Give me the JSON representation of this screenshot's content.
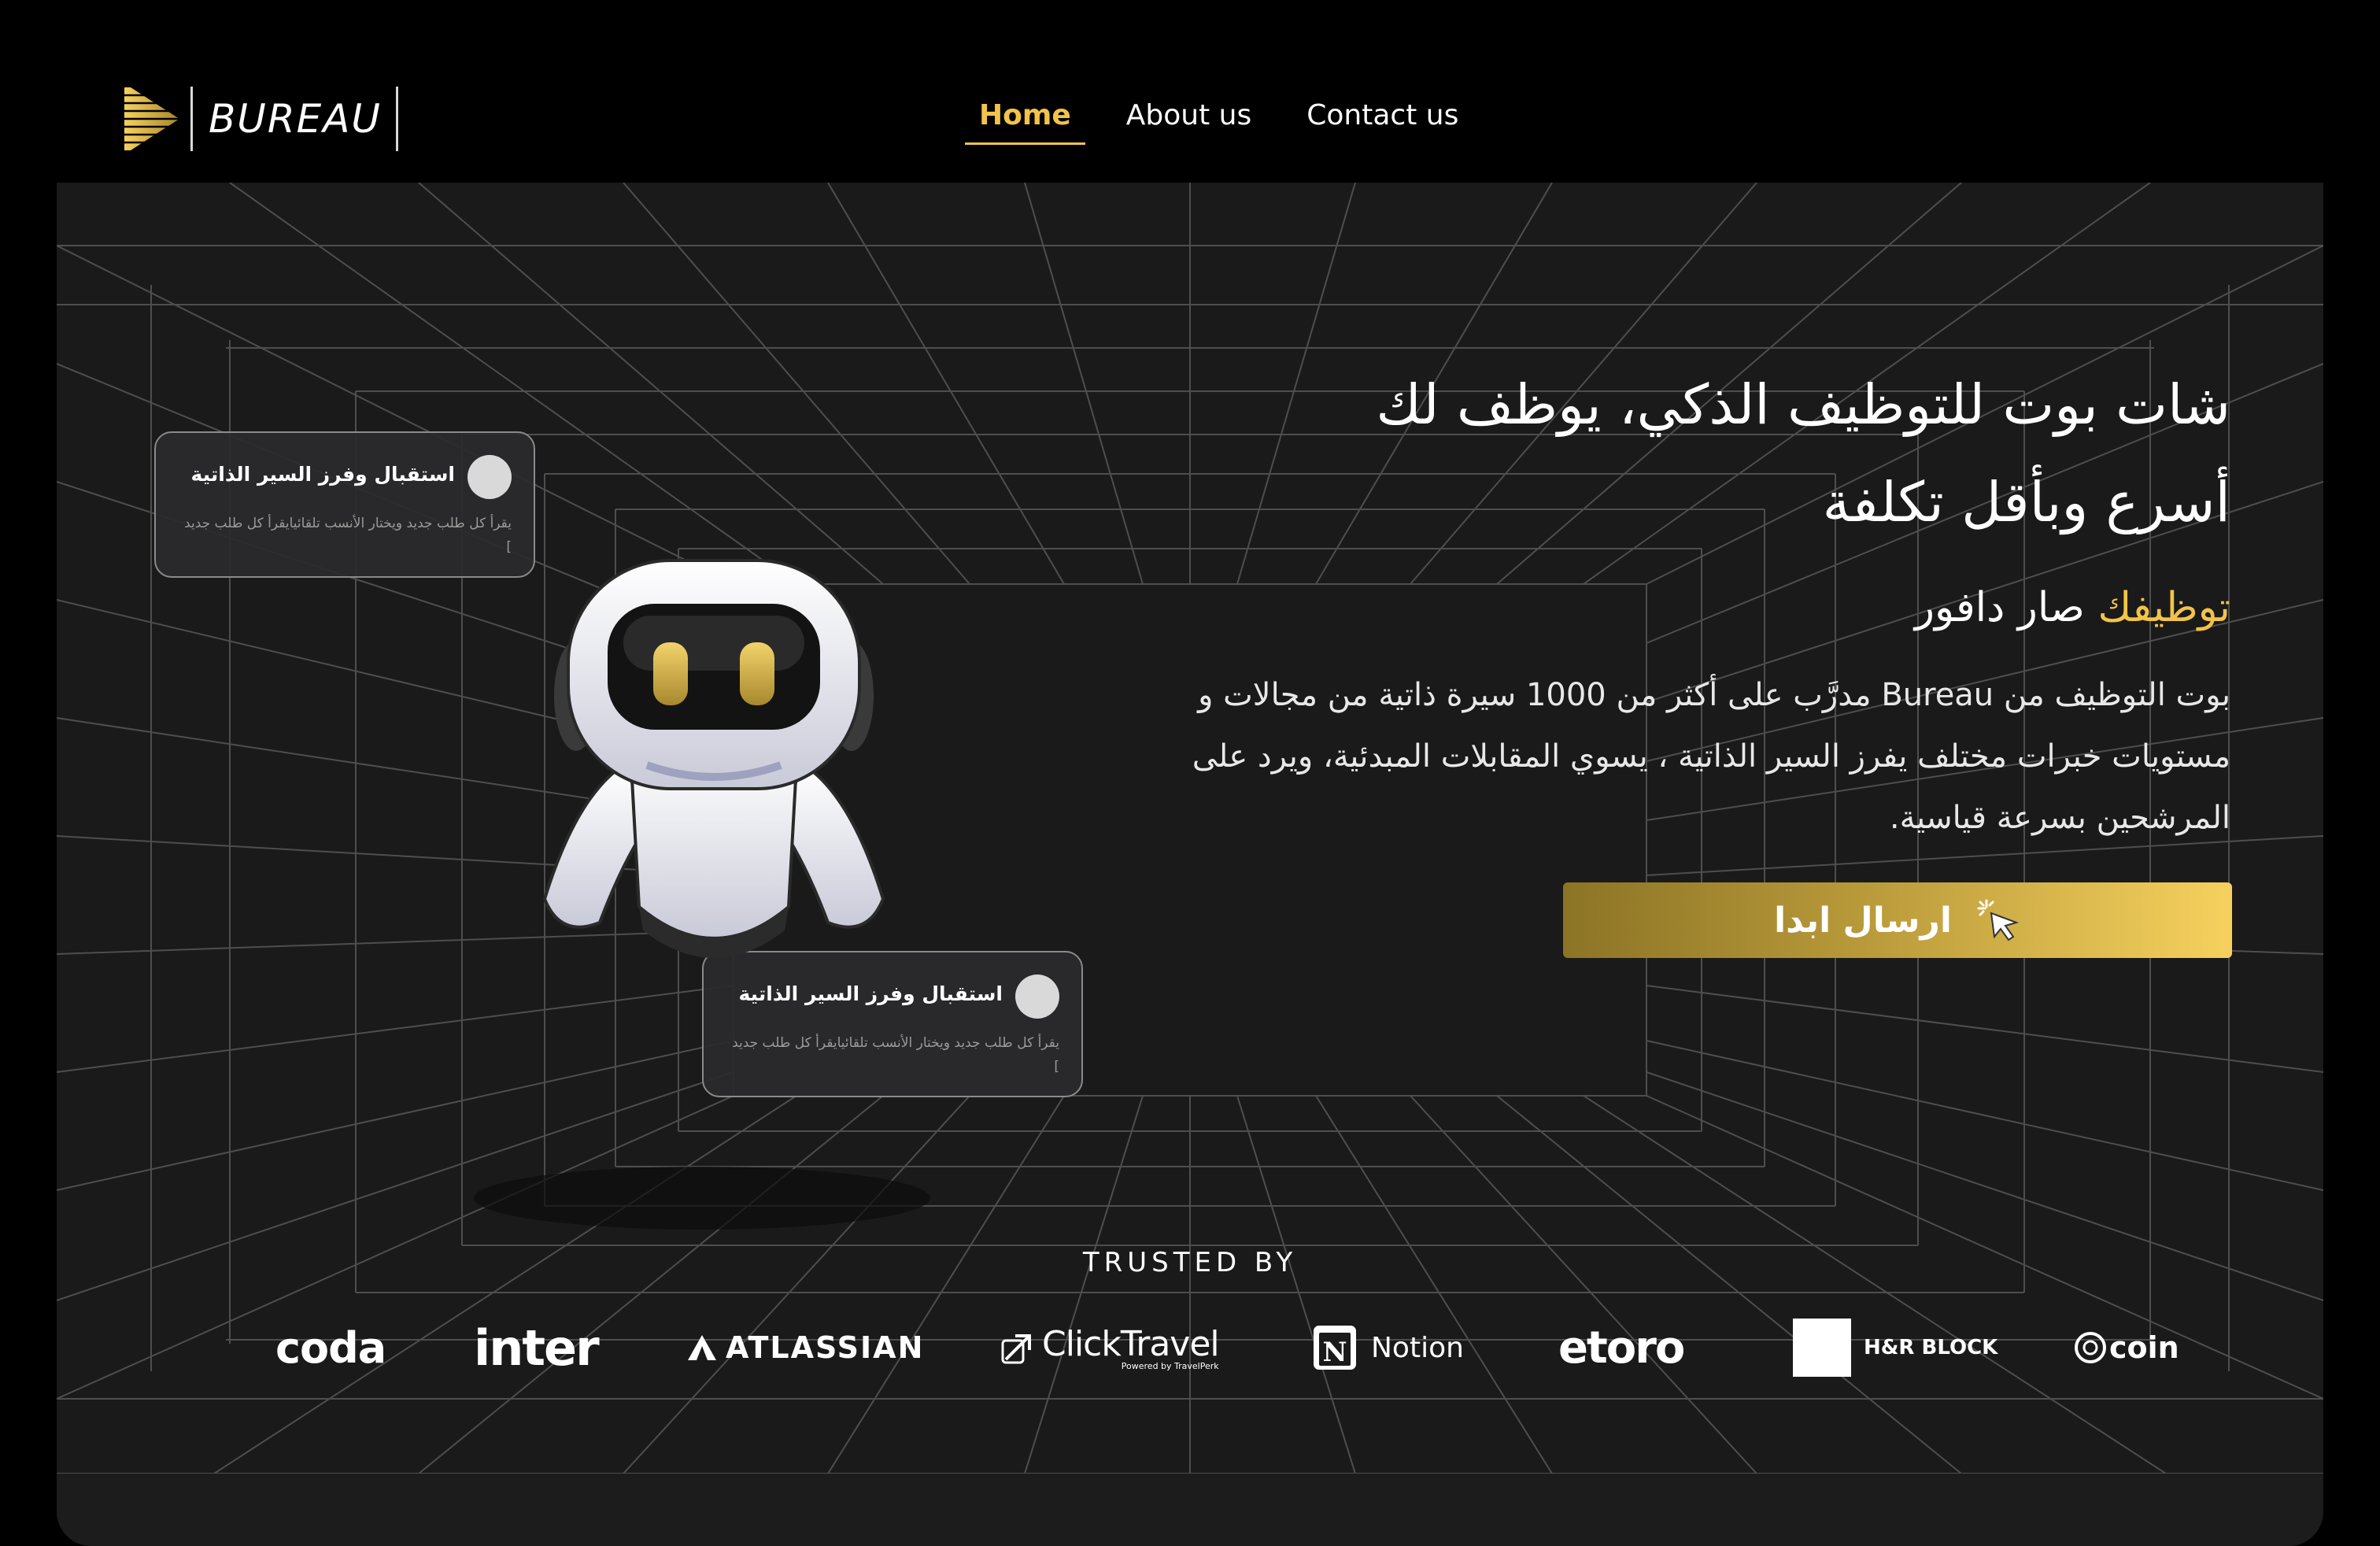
{
  "brand": {
    "name": "BUREAU",
    "logo_icon": "gold-speed-lines-icon"
  },
  "nav": {
    "items": [
      {
        "label": "Home",
        "active": true
      },
      {
        "label": "About us",
        "active": false
      },
      {
        "label": "Contact us",
        "active": false
      }
    ]
  },
  "hero": {
    "headline_line1": "شات بوت للتوظيف الذكي، يوظف لك",
    "headline_line2": "أسرع وبأقل تكلفة",
    "subhead_accent": "توظيفك",
    "subhead_rest": " صار دافور",
    "description": "بوت التوظيف من Bureau  مدرَّب على أكثر من 1000 سيرة ذاتية من مجالات و مستويات خبرات مختلف يفرز السير الذاتية ، يسوي المقابلات المبدئية، ويرد على المرشحين بسرعة قياسية.",
    "cta_label": "ارسال ابدا",
    "cta_icon": "cursor-click-icon"
  },
  "cards": [
    {
      "title": "استقبال وفرز السير الذاتية",
      "text": "يقرأ كل طلب جديد ويختار الأنسب تلقائيايقرأ كل طلب جديد ]"
    },
    {
      "title": "استقبال وفرز السير الذاتية",
      "text": "يقرأ كل طلب جديد ويختار الأنسب تلقائيايقرأ كل طلب جديد ]"
    }
  ],
  "trusted": {
    "label": "TRUSTED BY",
    "logos": [
      "coda",
      "inter",
      "ATLASSIAN",
      "ClickTravel",
      "Powered by TravelPerk",
      "Notion",
      "etoro",
      "H&R BLOCK",
      "coin"
    ]
  },
  "colors": {
    "accent": "#f2c34a",
    "background": "#000000",
    "hero_bg": "#1a1a1a",
    "grid": "#5a5a5a"
  }
}
